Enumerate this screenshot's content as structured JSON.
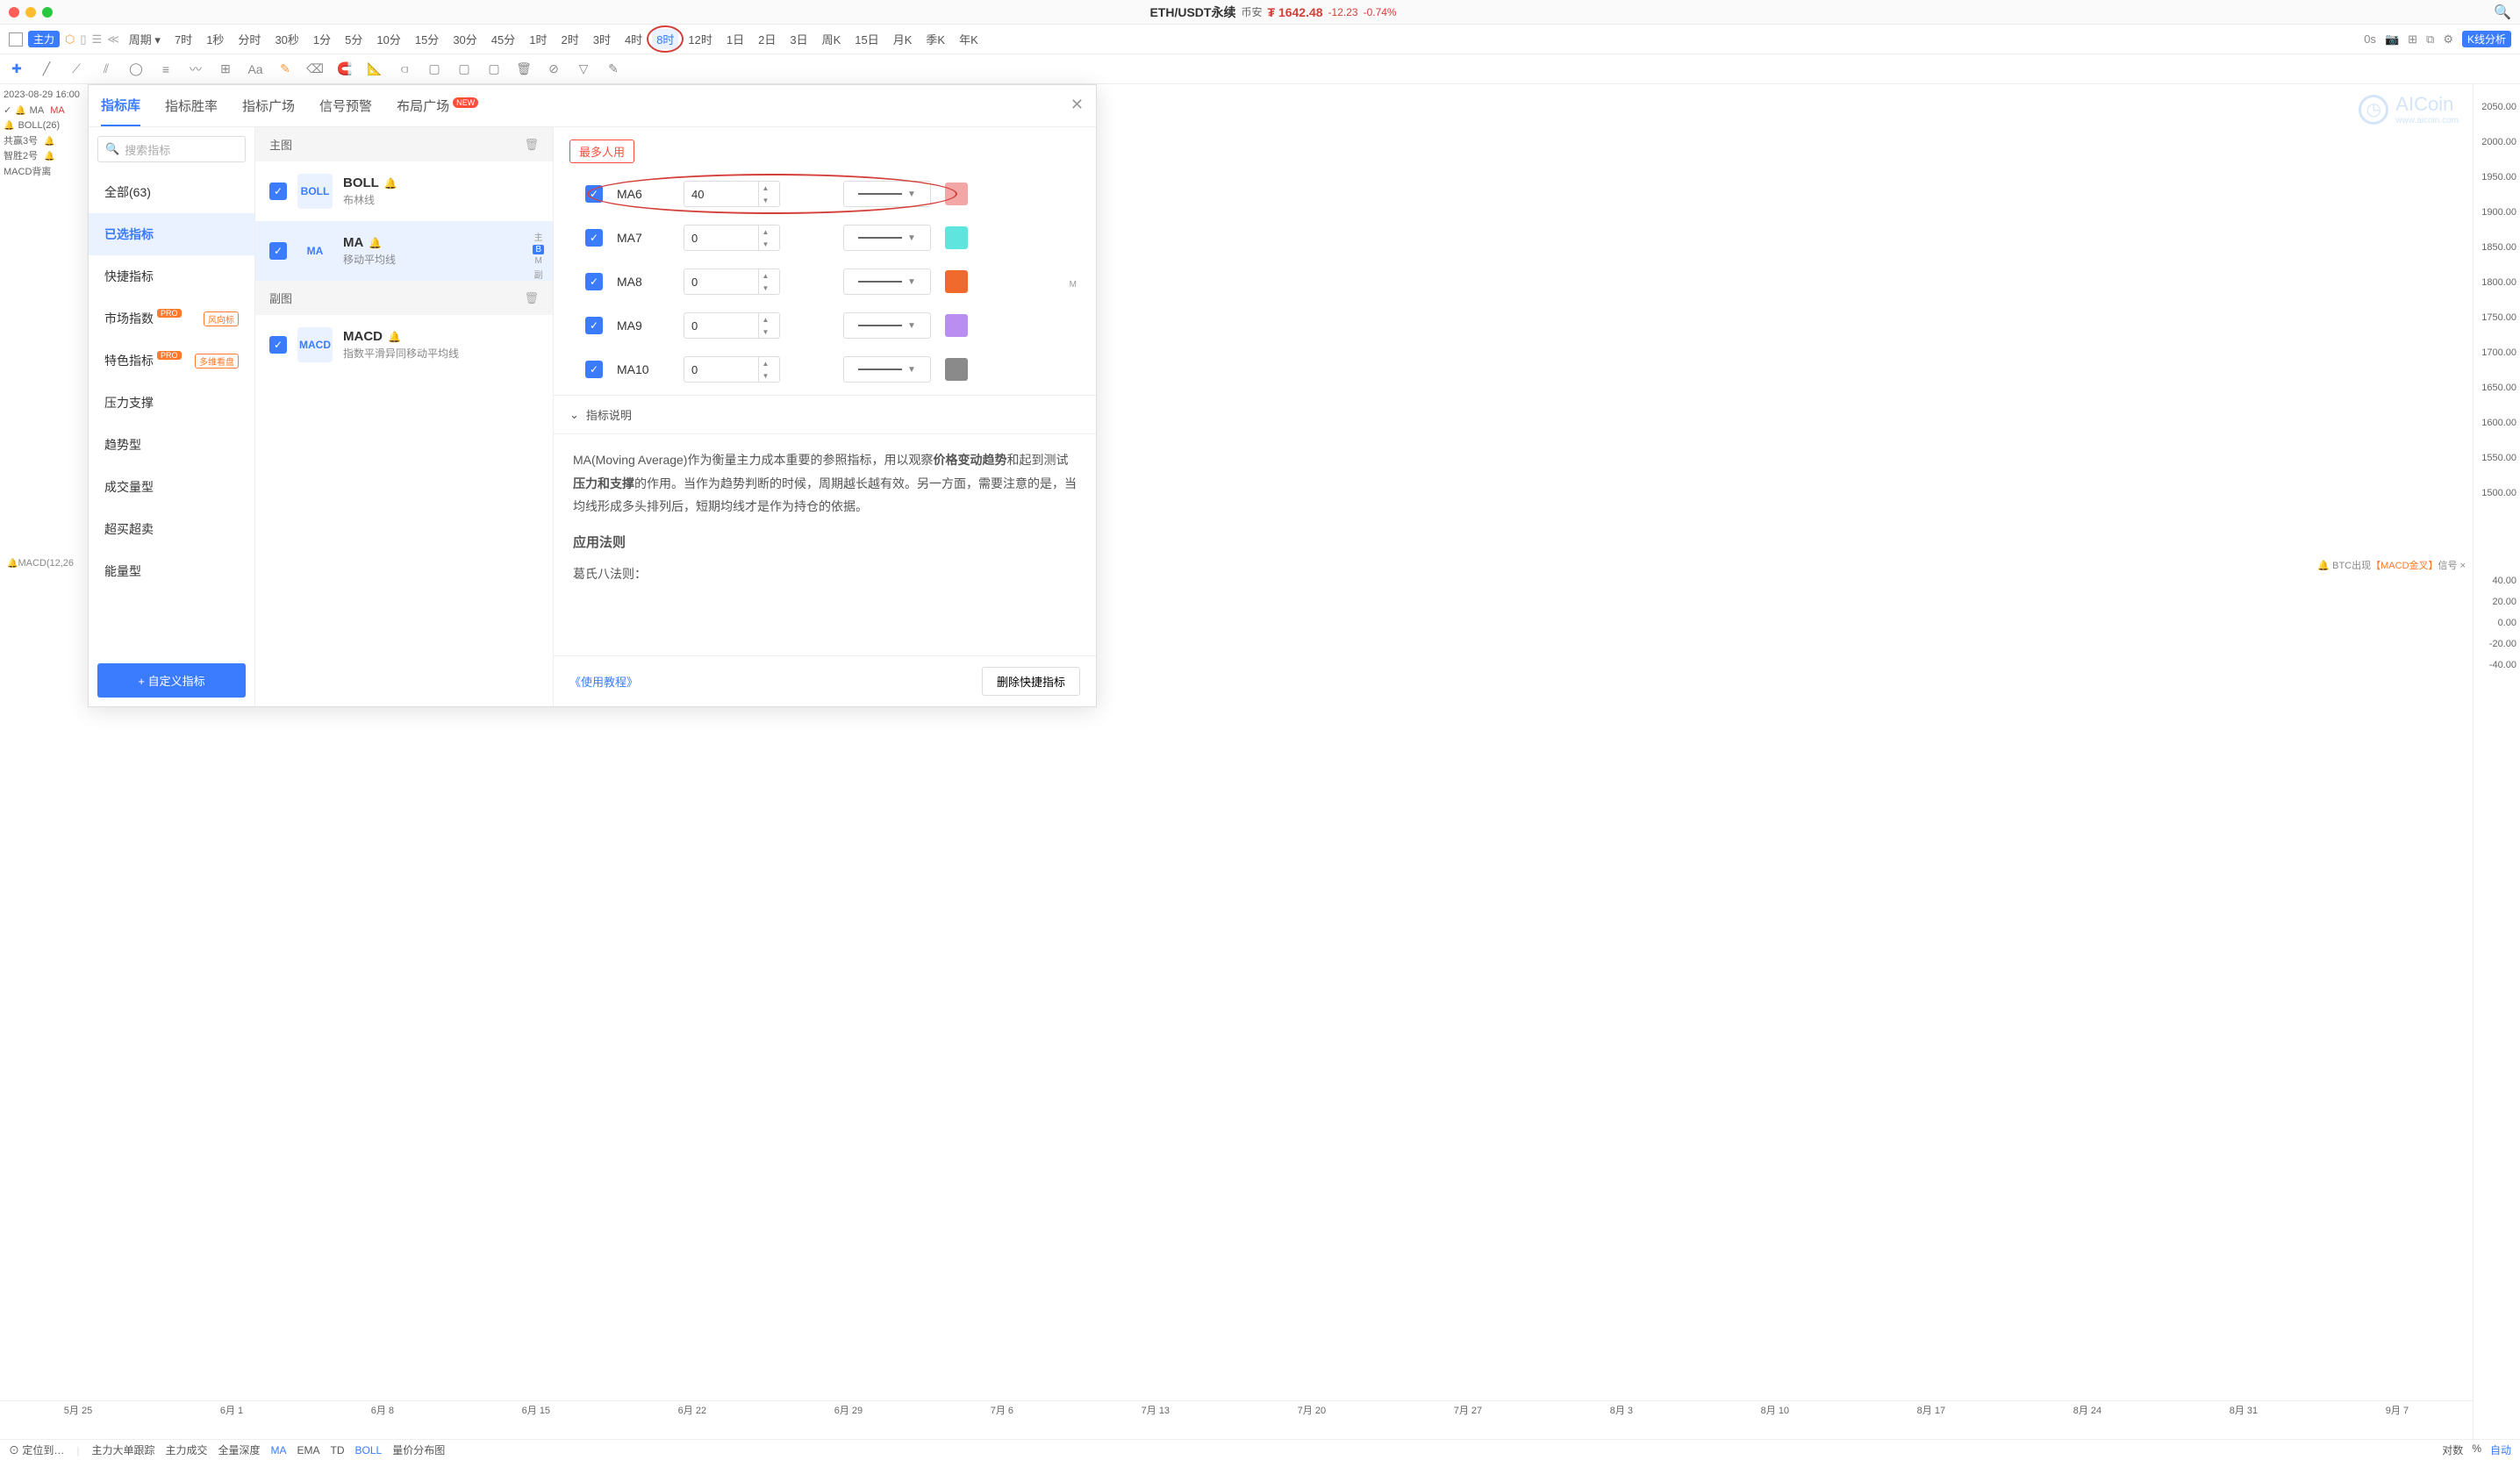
{
  "titlebar": {
    "pair": "ETH/USDT永续",
    "exchange": "币安",
    "price_prefix": "₮",
    "price": "1642.48",
    "delta": "-12.23",
    "pct": "-0.74%"
  },
  "tfbar": {
    "primary_badge": "主力",
    "period_label": "周期",
    "timeframes": [
      "7时",
      "1秒",
      "分时",
      "30秒",
      "1分",
      "5分",
      "10分",
      "15分",
      "30分",
      "45分",
      "1时",
      "2时",
      "3时",
      "4时",
      "8时",
      "12时",
      "1日",
      "2日",
      "3日",
      "周K",
      "15日",
      "月K",
      "季K",
      "年K"
    ],
    "active_tf": "8时",
    "right": {
      "zero_s": "0s",
      "kline_btn": "K线分析"
    }
  },
  "left_panel": {
    "timestamp": "2023-08-29 16:00",
    "rows": [
      {
        "icon": "✓",
        "label": "MA",
        "extra": "MA",
        "cls": "ma"
      },
      {
        "icon": "🔔",
        "label": "BOLL(26)",
        "extra": ""
      },
      {
        "label": "共赢3号",
        "bell": true
      },
      {
        "label": "智胜2号",
        "bell": true
      },
      {
        "label": "MACD背离",
        "bell": false
      }
    ]
  },
  "yaxis": [
    "2050.00",
    "2000.00",
    "1950.00",
    "1900.00",
    "1850.00",
    "1800.00",
    "1750.00",
    "1700.00",
    "1650.00",
    "1600.00",
    "1550.00",
    "1500.00"
  ],
  "yaxis2": [
    "40.00",
    "20.00",
    "0.00",
    "-20.00",
    "-40.00"
  ],
  "macd_label": "MACD(12,26",
  "signal_note": {
    "prefix": "🔔 BTC出现",
    "highlight": "【MACD金叉】",
    "suffix": "信号 ×"
  },
  "xaxis": [
    "5月 25",
    "6月 1",
    "6月 8",
    "6月 15",
    "6月 22",
    "6月 29",
    "7月 6",
    "7月 13",
    "7月 20",
    "7月 27",
    "8月 3",
    "8月 10",
    "8月 17",
    "8月 24",
    "8月 31",
    "9月 7"
  ],
  "modal": {
    "tabs": [
      "指标库",
      "指标胜率",
      "指标广场",
      "信号预警",
      "布局广场"
    ],
    "active_tab": "指标库",
    "new_on": "布局广场",
    "search_placeholder": "搜索指标",
    "categories": [
      {
        "label": "全部(63)"
      },
      {
        "label": "已选指标",
        "active": true
      },
      {
        "label": "快捷指标"
      },
      {
        "label": "市场指数",
        "pro": true,
        "tag": "风向标"
      },
      {
        "label": "特色指标",
        "pro": true,
        "tag": "多维看盘"
      },
      {
        "label": "压力支撑"
      },
      {
        "label": "趋势型"
      },
      {
        "label": "成交量型"
      },
      {
        "label": "超买超卖"
      },
      {
        "label": "能量型"
      }
    ],
    "custom_btn": "+ 自定义指标",
    "sections": {
      "main": "主图",
      "sub": "副图"
    },
    "indicators_main": [
      {
        "code": "BOLL",
        "title": "BOLL",
        "sub": "布林线"
      },
      {
        "code": "MA",
        "title": "MA",
        "sub": "移动平均线",
        "selected": true,
        "tags": [
          "主",
          "B",
          "M",
          "副"
        ]
      }
    ],
    "indicators_sub": [
      {
        "code": "MACD",
        "title": "MACD",
        "sub": "指数平滑异同移动平均线"
      }
    ],
    "most_used": "最多人用",
    "params": [
      {
        "name": "MA6",
        "value": "40",
        "color": "#f3a6a6",
        "highlight": true
      },
      {
        "name": "MA7",
        "value": "0",
        "color": "#5ee5dd"
      },
      {
        "name": "MA8",
        "value": "0",
        "color": "#f06a2e"
      },
      {
        "name": "MA9",
        "value": "0",
        "color": "#b98ef0"
      },
      {
        "name": "MA10",
        "value": "0",
        "color": "#8a8a8a"
      }
    ],
    "desc_title": "指标说明",
    "desc_p1a": "MA(Moving Average)作为衡量主力成本重要的参照指标，用以观察",
    "desc_p1b": "价格变动趋势",
    "desc_p1c": "和起到测试",
    "desc_p1d": "压力和支撑",
    "desc_p1e": "的作用。当作为趋势判断的时候，周期越长越有效。另一方面，需要注意的是，当均线形成多头排列后，短期均线才是作为持仓的依据。",
    "desc_h": "应用法则",
    "desc_p2": "葛氏八法则：",
    "tutorial": "《使用教程》",
    "del_btn": "删除快捷指标"
  },
  "watermark": {
    "name": "AICoin",
    "url": "www.aicoin.com"
  },
  "statusbar": {
    "locate": "定位到…",
    "items": [
      "主力大单跟踪",
      "主力成交",
      "全量深度",
      "MA",
      "EMA",
      "TD",
      "BOLL",
      "量价分布图"
    ],
    "blue_items": [
      "MA",
      "BOLL"
    ],
    "right": [
      "对数",
      "%",
      "自动"
    ]
  }
}
